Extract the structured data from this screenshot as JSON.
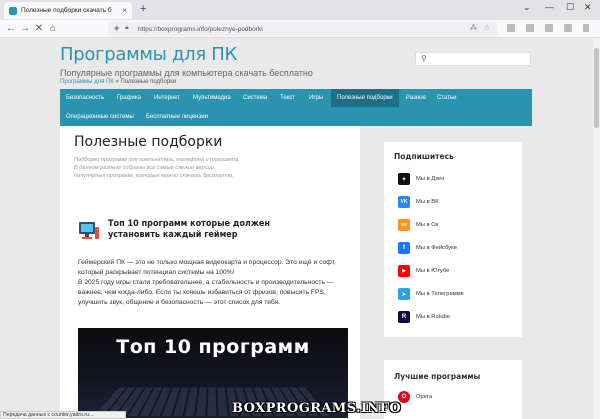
{
  "browser": {
    "tab_title": "Полезные подборки скачать б",
    "url": "https://boxprograms.info/poleznye-podborki"
  },
  "site": {
    "title": "Программы для ПК",
    "subtitle": "Популярные программы для компьютера скачать бесплатно",
    "breadcrumb_home": "Программы для ПК",
    "breadcrumb_sep": "»",
    "breadcrumb_current": "Полезные подборки"
  },
  "menu": [
    {
      "label": "Безопасность"
    },
    {
      "label": "Графика"
    },
    {
      "label": "Интернет"
    },
    {
      "label": "Мультимедиа"
    },
    {
      "label": "Система"
    },
    {
      "label": "Текст"
    },
    {
      "label": "Игры"
    },
    {
      "label": "Полезные подборки",
      "active": true
    },
    {
      "label": "Разное"
    },
    {
      "label": "Статьи"
    },
    {
      "label": "Операционные системы"
    },
    {
      "label": "Бесплатные лицензии"
    }
  ],
  "category": {
    "title": "Полезные подборки",
    "description_lines": [
      "Подборки программ для компьютера, телефона и планшета.",
      "В данном разделе собраны все самые свежие версии",
      "популярных программ, которые можно скачать бесплатно."
    ]
  },
  "post": {
    "title": "Топ 10 программ которые должен установить каждый геймер",
    "paragraph1": "Геймерский ПК — это не только мощная видеокарта и процессор. Это ещё и софт, который раскрывает потенциал системы на 100%!",
    "paragraph2": "В 2025 году игры стали требовательнее, а стабильность и производительность — важнее, чем когда-либо. Если ты хочешь избавиться от фризов, повысить FPS, улучшить звук, общение и безопасность — этот список для тебя.",
    "image_text": "Топ 10 программ"
  },
  "sidebar": {
    "subscribe_title": "Подпишитесь",
    "subscribe_items": [
      {
        "label": "Мы в Дзен",
        "color": "#111111",
        "glyph": "✦"
      },
      {
        "label": "Мы в ВК",
        "color": "#2787f5",
        "glyph": "VK"
      },
      {
        "label": "Мы в Ок",
        "color": "#f7931e",
        "glyph": "ок"
      },
      {
        "label": "Мы в Фейсбуке",
        "color": "#1877f2",
        "glyph": "f"
      },
      {
        "label": "Мы в Ютубе",
        "color": "#ff0000",
        "glyph": "▶"
      },
      {
        "label": "Мы в Телеграмме",
        "color": "#2aa3df",
        "glyph": "➤"
      },
      {
        "label": "Мы в Rutube",
        "color": "#100943",
        "glyph": "R"
      }
    ],
    "best_title": "Лучшие программы",
    "best_items": [
      {
        "label": "Opera",
        "color": "#e0001b",
        "glyph": "O"
      }
    ]
  },
  "status_text": "Передача данных с counter.yadro.ru...",
  "watermark": "BOXPROGRAMS.INFO"
}
